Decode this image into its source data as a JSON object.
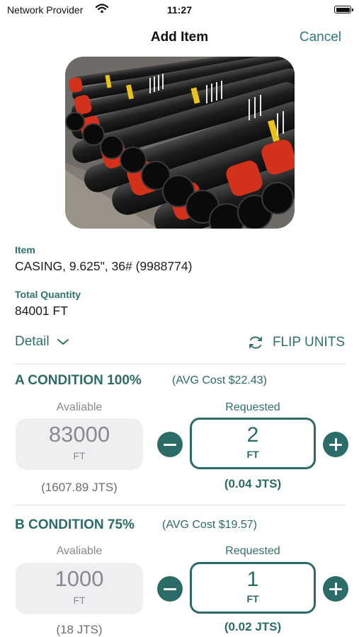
{
  "status": {
    "provider": "Network Provider",
    "time": "11:27"
  },
  "nav": {
    "title": "Add Item",
    "cancel": "Cancel"
  },
  "item": {
    "label": "Item",
    "value": "CASING, 9.625\", 36# (9988774)"
  },
  "quantity": {
    "label": "Total Quantity",
    "value": "84001 FT"
  },
  "controls": {
    "detail": "Detail",
    "flip": "FLIP UNITS"
  },
  "colors": {
    "accent": "#2b6b68",
    "link": "#2e7b78",
    "available_bg": "#efeff2"
  },
  "icons": {
    "wifi": "wifi-icon",
    "battery": "battery-icon",
    "chevron": "chevron-down-icon",
    "flip": "refresh-icon",
    "minus": "minus-icon",
    "plus": "plus-icon"
  },
  "conditions": [
    {
      "title": "A CONDITION 100%",
      "avg": "(AVG Cost $22.43)",
      "available_label": "Avaliable",
      "available": "83000",
      "available_unit": "FT",
      "available_jts": "(1607.89 JTS)",
      "requested_label": "Requested",
      "requested": "2",
      "requested_unit": "FT",
      "requested_jts": "(0.04 JTS)"
    },
    {
      "title": "B CONDITION 75%",
      "avg": "(AVG Cost $19.57)",
      "available_label": "Avaliable",
      "available": "1000",
      "available_unit": "FT",
      "available_jts": "(18 JTS)",
      "requested_label": "Requested",
      "requested": "1",
      "requested_unit": "FT",
      "requested_jts": "(0.02 JTS)"
    }
  ]
}
